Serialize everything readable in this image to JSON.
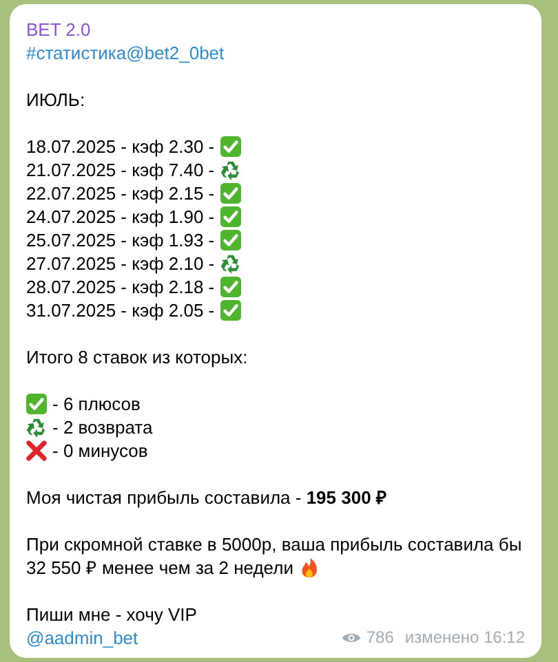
{
  "message": {
    "channel": "BET 2.0",
    "hashtag": "#статистика@bet2_0bet",
    "month": "ИЮЛЬ:",
    "bets": [
      {
        "text": "18.07.2025 - кэф 2.30 -",
        "kind": "win"
      },
      {
        "text": "21.07.2025 - кэф 7.40 -",
        "kind": "refund"
      },
      {
        "text": "22.07.2025 - кэф 2.15 -",
        "kind": "win"
      },
      {
        "text": "24.07.2025 - кэф 1.90 -",
        "kind": "win"
      },
      {
        "text": "25.07.2025 - кэф 1.93 -",
        "kind": "win"
      },
      {
        "text": "27.07.2025 - кэф 2.10 -",
        "kind": "refund"
      },
      {
        "text": "28.07.2025 - кэф 2.18 -",
        "kind": "win"
      },
      {
        "text": "31.07.2025 - кэф 2.05 -",
        "kind": "win"
      }
    ],
    "summary": "Итого 8 ставок из которых:",
    "legend": [
      {
        "kind": "win",
        "text": "- 6 плюсов"
      },
      {
        "kind": "refund",
        "text": "- 2 возврата"
      },
      {
        "kind": "loss",
        "text": "- 0 минусов"
      }
    ],
    "profit": "Моя чистая прибыль составила - **195 300 ₽**",
    "promo": [
      "При скромной ставке в 5000р, ваша прибыль составила бы",
      "32 550 ₽ менее чем за 2 недели"
    ],
    "cta": "Пиши мне - хочу VIP",
    "contact": "@aadmin_bet",
    "views": "786",
    "edited": "изменено 16:12"
  }
}
